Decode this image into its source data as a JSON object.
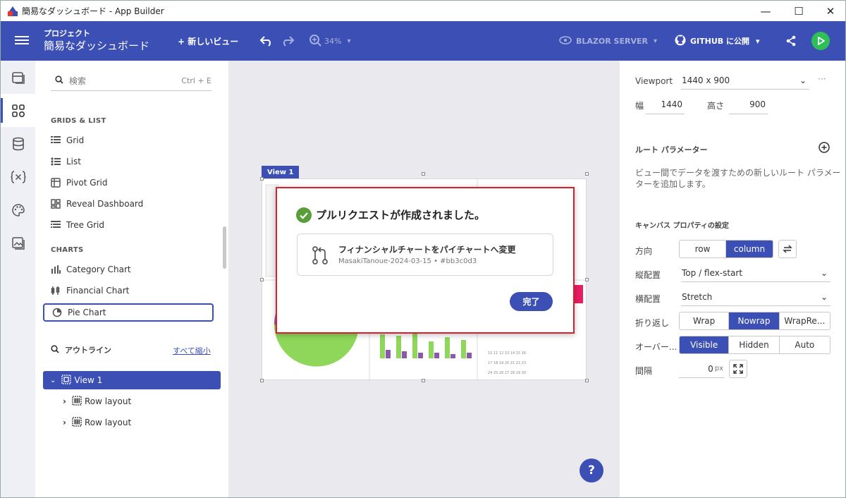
{
  "window": {
    "title": "簡易なダッシュボード - App Builder",
    "minimize": "—",
    "maximize": "☐",
    "close": "✕"
  },
  "header": {
    "project_label": "プロジェクト",
    "project_name": "簡易なダッシュボード",
    "new_view": "+ 新しいビュー",
    "zoom": "34%",
    "platform": "BLAZOR SERVER",
    "github": "GITHUB に公開"
  },
  "left_panel": {
    "search_placeholder": "検索",
    "search_shortcut": "Ctrl + E",
    "grids_title": "GRIDS & LIST",
    "grids": [
      "Grid",
      "List",
      "Pivot Grid",
      "Reveal Dashboard",
      "Tree Grid"
    ],
    "charts_title": "CHARTS",
    "charts": [
      "Category Chart",
      "Financial Chart",
      "Pie Chart"
    ],
    "outline_title": "アウトライン",
    "collapse_all": "すべて縮小",
    "outline": [
      "View 1",
      "Row layout",
      "Row layout"
    ]
  },
  "canvas": {
    "view_tab": "View 1",
    "modal": {
      "title": "プルリクエストが作成されました。",
      "card_title": "フィナンシャルチャートをパイチャートへ変更",
      "card_sub": "MasakiTanoue-2024-03-15 • #bb3c0d3",
      "done": "完了"
    },
    "help": "?"
  },
  "right_panel": {
    "viewport_label": "Viewport",
    "viewport_value": "1440 x 900",
    "width_label": "幅",
    "width_value": "1440",
    "height_label": "高さ",
    "height_value": "900",
    "route_title": "ルート パラメーター",
    "route_desc_1": "ビュー間でデータを渡すための新しいルート パラメー",
    "route_desc_2": "ターを追加します。",
    "canvas_title": "キャンバス プロパティの設定",
    "direction_label": "方向",
    "direction_options": [
      "row",
      "column"
    ],
    "valign_label": "縦配置",
    "valign_value": "Top / flex-start",
    "halign_label": "横配置",
    "halign_value": "Stretch",
    "wrap_label": "折り返し",
    "wrap_options": [
      "Wrap",
      "Nowrap",
      "WrapRe..."
    ],
    "overflow_label": "オーバー...",
    "overflow_options": [
      "Visible",
      "Hidden",
      "Auto"
    ],
    "gap_label": "間隔",
    "gap_value": "0",
    "gap_unit": "px"
  },
  "colors": {
    "accent": "#3c4fb4",
    "danger": "#d8202c",
    "success": "#5a9e3c"
  }
}
